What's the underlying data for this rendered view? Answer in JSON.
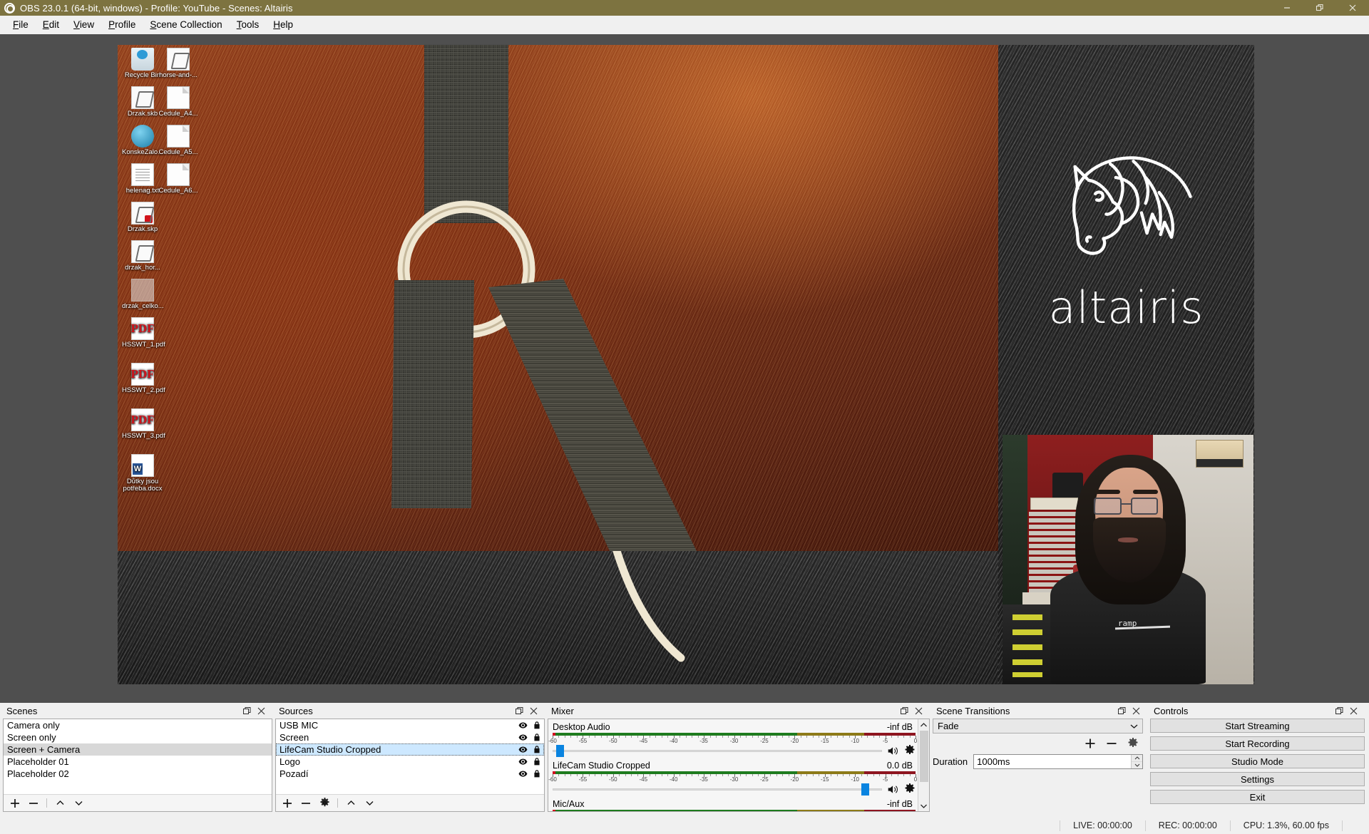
{
  "window": {
    "title": "OBS 23.0.1 (64-bit, windows) - Profile: YouTube - Scenes: Altairis",
    "minimize_label": "Minimize",
    "restore_label": "Restore",
    "close_label": "Close"
  },
  "menubar": {
    "items": [
      {
        "label": "File",
        "mnemonic": "F"
      },
      {
        "label": "Edit",
        "mnemonic": "E"
      },
      {
        "label": "View",
        "mnemonic": "V"
      },
      {
        "label": "Profile",
        "mnemonic": "P"
      },
      {
        "label": "Scene Collection",
        "mnemonic": "S"
      },
      {
        "label": "Tools",
        "mnemonic": "T"
      },
      {
        "label": "Help",
        "mnemonic": "H"
      }
    ]
  },
  "preview": {
    "logo_text": "altairis",
    "desktop_icons": [
      {
        "name": "Recycle Bin",
        "type": "bin"
      },
      {
        "name": "horse-and-...",
        "type": "sk"
      },
      {
        "name": "Drzak.skb",
        "type": "sk"
      },
      {
        "name": "Cedule_A4...",
        "type": "file"
      },
      {
        "name": "KonskeZalo...",
        "type": "blue"
      },
      {
        "name": "Cedule_A5...",
        "type": "file"
      },
      {
        "name": "helenag.txt",
        "type": "txt"
      },
      {
        "name": "Cedule_A6...",
        "type": "file"
      },
      {
        "name": "Drzak.skp",
        "type": "sk"
      },
      {
        "name": "drzak_hor...",
        "type": "sk"
      },
      {
        "name": "drzak_celko...",
        "type": "ghost"
      },
      {
        "name": "HSSWT_1.pdf",
        "type": "pdf"
      },
      {
        "name": "HSSWT_2.pdf",
        "type": "pdf"
      },
      {
        "name": "HSSWT_3.pdf",
        "type": "pdf"
      },
      {
        "name": "Důtky jsou potřeba.docx",
        "type": "doc"
      }
    ],
    "webcam_shirt_text": "ramp"
  },
  "scenes": {
    "panel_title": "Scenes",
    "items": [
      {
        "label": "Camera only",
        "selected": false
      },
      {
        "label": "Screen only",
        "selected": false
      },
      {
        "label": "Screen + Camera",
        "selected": true
      },
      {
        "label": "Placeholder 01",
        "selected": false
      },
      {
        "label": "Placeholder 02",
        "selected": false
      }
    ],
    "toolbar": {
      "add": "+",
      "remove": "−",
      "move_up": "Move up",
      "move_down": "Move down"
    }
  },
  "sources": {
    "panel_title": "Sources",
    "items": [
      {
        "label": "USB MIC",
        "selected": false,
        "visible": true,
        "locked": true
      },
      {
        "label": "Screen",
        "selected": false,
        "visible": true,
        "locked": true
      },
      {
        "label": "LifeCam Studio Cropped",
        "selected": true,
        "visible": true,
        "locked": true
      },
      {
        "label": "Logo",
        "selected": false,
        "visible": true,
        "locked": true
      },
      {
        "label": "Pozadí",
        "selected": false,
        "visible": true,
        "locked": true
      }
    ],
    "toolbar": {
      "add": "+",
      "remove": "−",
      "properties": "Properties",
      "move_up": "Move up",
      "move_down": "Move down"
    }
  },
  "mixer": {
    "panel_title": "Mixer",
    "tick_labels": [
      "-60",
      "-55",
      "-50",
      "-45",
      "-40",
      "-35",
      "-30",
      "-25",
      "-20",
      "-15",
      "-10",
      "-5",
      "0"
    ],
    "channels": [
      {
        "name": "Desktop Audio",
        "db": "-inf dB",
        "volume_pct": 1,
        "muted": false
      },
      {
        "name": "LifeCam Studio Cropped",
        "db": "0.0 dB",
        "volume_pct": 96,
        "muted": false
      },
      {
        "name": "Mic/Aux",
        "db": "-inf dB",
        "volume_pct": 1,
        "muted": false
      }
    ]
  },
  "transitions": {
    "panel_title": "Scene Transitions",
    "selected": "Fade",
    "add_label": "+",
    "remove_label": "−",
    "properties_label": "Properties",
    "duration_label": "Duration",
    "duration_value": "1000ms"
  },
  "controls": {
    "panel_title": "Controls",
    "buttons": [
      {
        "label": "Start Streaming"
      },
      {
        "label": "Start Recording"
      },
      {
        "label": "Studio Mode"
      },
      {
        "label": "Settings"
      },
      {
        "label": "Exit"
      }
    ]
  },
  "statusbar": {
    "live": "LIVE: 00:00:00",
    "rec": "REC: 00:00:00",
    "cpu": "CPU: 1.3%, 60.00 fps"
  },
  "colors": {
    "titlebar": "#7d7340",
    "selection_blue": "#cde8ff",
    "selection_gray": "#d8d8d8",
    "slider_blue": "#0a84e0",
    "meter_green": "#1e7b1e",
    "meter_yellow": "#8d7a18",
    "meter_red": "#8e1520"
  }
}
